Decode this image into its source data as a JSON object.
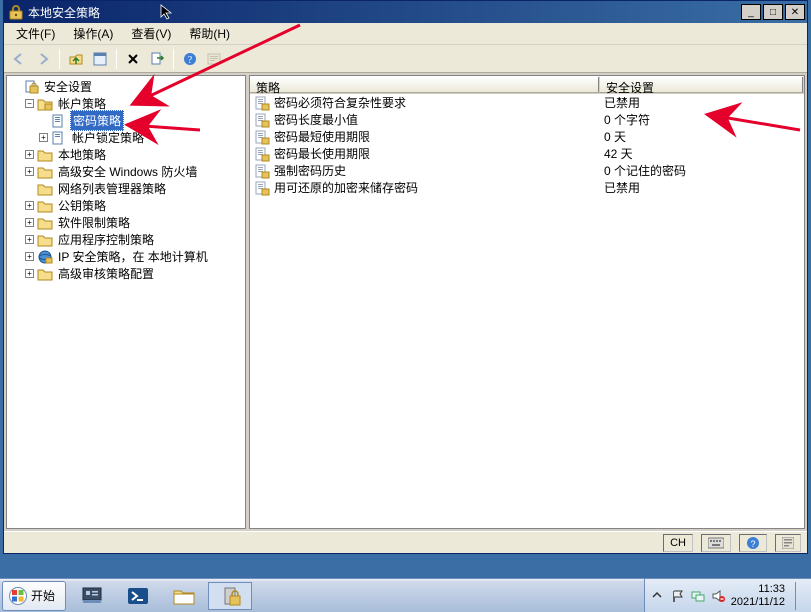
{
  "window": {
    "title": "本地安全策略"
  },
  "menu": {
    "file": "文件(F)",
    "action": "操作(A)",
    "view": "查看(V)",
    "help": "帮助(H)"
  },
  "tree": {
    "root": "安全设置",
    "account_policy": "帐户策略",
    "password_policy": "密码策略",
    "account_lockout": "帐户锁定策略",
    "local_policy": "本地策略",
    "adv_firewall": "高级安全 Windows 防火墙",
    "network_list": "网络列表管理器策略",
    "public_key": "公钥策略",
    "software_restrict": "软件限制策略",
    "app_control": "应用程序控制策略",
    "ip_security": "IP 安全策略，在 本地计算机",
    "adv_audit": "高级审核策略配置"
  },
  "columns": {
    "policy": "策略",
    "setting": "安全设置"
  },
  "policies": [
    {
      "name": "密码必须符合复杂性要求",
      "value": "已禁用"
    },
    {
      "name": "密码长度最小值",
      "value": "0 个字符"
    },
    {
      "name": "密码最短使用期限",
      "value": "0 天"
    },
    {
      "name": "密码最长使用期限",
      "value": "42 天"
    },
    {
      "name": "强制密码历史",
      "value": "0 个记住的密码"
    },
    {
      "name": "用可还原的加密来储存密码",
      "value": "已禁用"
    }
  ],
  "status": {
    "lang": "CH"
  },
  "taskbar": {
    "start": "开始",
    "time": "11:33",
    "date": "2021/11/12"
  }
}
